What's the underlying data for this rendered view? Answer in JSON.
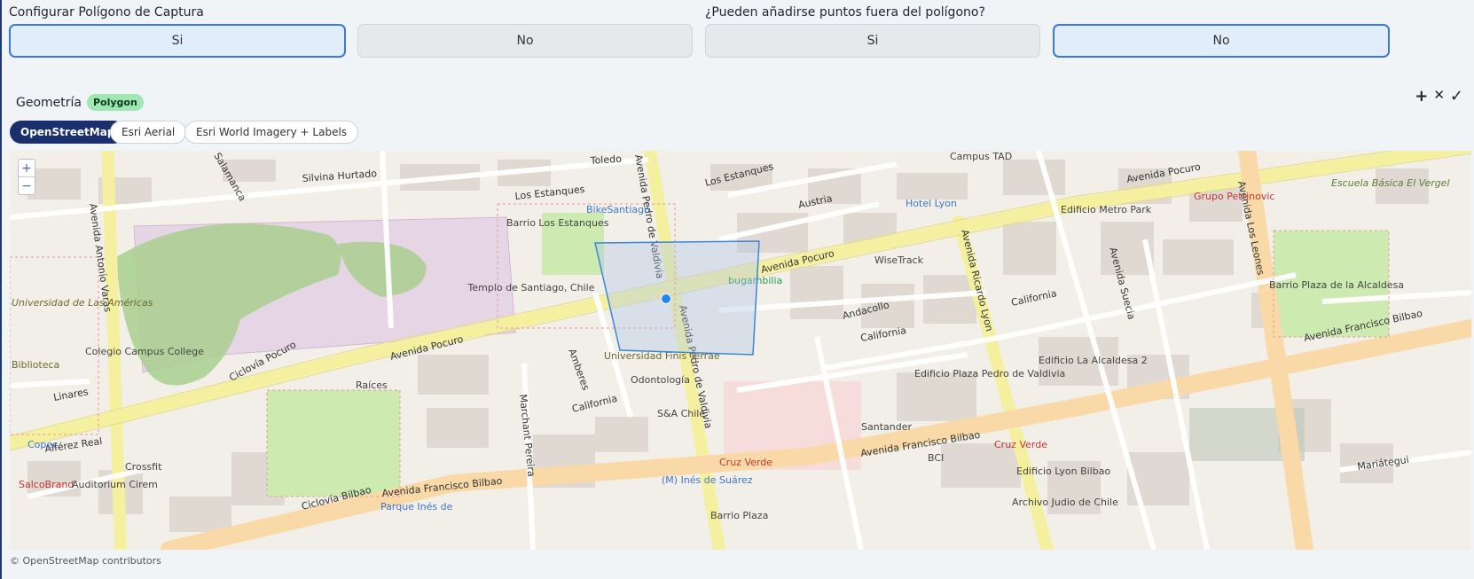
{
  "capture": {
    "label": "Configurar Polígono de Captura",
    "options": [
      {
        "label": "Si",
        "selected": true
      },
      {
        "label": "No",
        "selected": false
      }
    ]
  },
  "outside": {
    "label": "¿Pueden añadirse puntos fuera del polígono?",
    "options": [
      {
        "label": "Si",
        "selected": false
      },
      {
        "label": "No",
        "selected": true
      }
    ]
  },
  "geometry": {
    "label": "Geometría",
    "type_badge": "Polygon"
  },
  "tools": {
    "add": "+",
    "clear": "✕",
    "confirm": "✓"
  },
  "layers": [
    {
      "label": "OpenStreetMap",
      "active": true
    },
    {
      "label": "Esri Aerial",
      "active": false
    },
    {
      "label": "Esri World Imagery + Labels",
      "active": false
    }
  ],
  "map": {
    "zoom_in": "+",
    "zoom_out": "−",
    "attribution": "© OpenStreetMap contributors",
    "streets": {
      "pocuro": "Avenida Pocuro",
      "bilbao": "Avenida Francisco Bilbao",
      "pedro_valdivia": "Avenida Pedro de Valdivia",
      "ricardo_lyon": "Avenida Ricardo Lyon",
      "los_leones": "Avenida Los Leones",
      "antonio_varas": "Avenida Antonio Varas",
      "suecia": "Avenida Suecia",
      "california": "California",
      "andacollo": "Andacollo",
      "los_estanques": "Los Estanques",
      "toledo": "Toledo",
      "silvina_hurtado": "Silvina Hurtado",
      "austria": "Austria",
      "linares": "Linares",
      "alferez_real": "Alférez Real",
      "marchant_pereira": "Marchant Pereira",
      "ciclovia_pocuro": "Ciclovía Pocuro",
      "ciclovia_bilbao": "Ciclovía Bilbao",
      "amberes": "Amberes",
      "mariategui": "Mariátegui",
      "salamanca": "Salamanca"
    },
    "places": {
      "templo": "Templo de Santiago, Chile",
      "barrio_estanques": "Barrio Los Estanques",
      "barrio_plaza": "Barrio Plaza de la Alcaldesa",
      "bikesantiago": "BikeSantiago",
      "hotel_lyon": "Hotel Lyon",
      "wisetrack": "WiseTrack",
      "grupo_petrinovic": "Grupo Petrinovic",
      "escuela": "Escuela Básica El Vergel",
      "univ_finis": "Universidad Finis Terrae",
      "odontologia": "Odontología",
      "bugambilia": "bugambilia",
      "cruz_verde": "Cruz Verde",
      "santander": "Santander",
      "bci": "BCI",
      "metro_ines": "(M) Inés de Suárez",
      "salcobrand": "SalcoBrand",
      "auditorium": "Auditorium Cirem",
      "copec": "Copec",
      "crossfit": "Crossfit",
      "raices": "Raíces",
      "edif_pedro": "Edificio Plaza Pedro de Valdivia",
      "edif_alcaldesa": "Edificio La Alcaldesa 2",
      "edif_metro": "Edificio Metro Park",
      "edif_lyon_bilbao": "Edificio Lyon Bilbao",
      "archivo": "Archivo Judio de Chile",
      "campus_tad": "Campus TAD",
      "colegio": "Colegio Campus College",
      "biblioteca": "Biblioteca",
      "univ_americas": "Universidad de Las Américas",
      "sa_chile": "S&A Chile",
      "barrio_plaza_bottom": "Barrio Plaza",
      "parque_ines": "Parque Inés de"
    }
  }
}
